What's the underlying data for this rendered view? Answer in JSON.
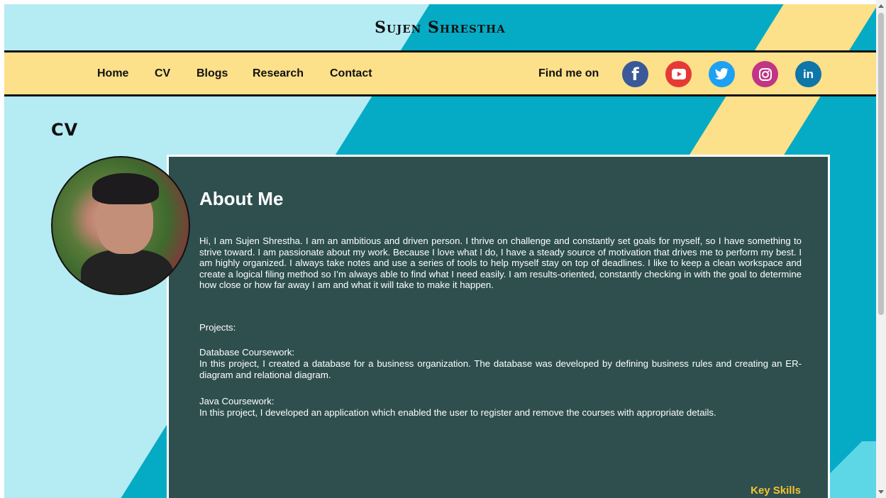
{
  "site": {
    "title": "Sujen Shrestha"
  },
  "nav": {
    "items": [
      {
        "label": "Home"
      },
      {
        "label": "CV"
      },
      {
        "label": "Blogs"
      },
      {
        "label": "Research"
      },
      {
        "label": "Contact"
      }
    ],
    "find_label": "Find me on",
    "socials": [
      {
        "name": "facebook-icon",
        "glyph": "f",
        "color": "#3b5998"
      },
      {
        "name": "youtube-icon",
        "glyph": "",
        "color": "#e53935"
      },
      {
        "name": "twitter-icon",
        "glyph": "",
        "color": "#1da1f2"
      },
      {
        "name": "instagram-icon",
        "glyph": "",
        "color": "#c13584"
      },
      {
        "name": "linkedin-icon",
        "glyph": "in",
        "color": "#0e76a8"
      }
    ]
  },
  "page": {
    "heading": "CV"
  },
  "about": {
    "title": "About Me",
    "intro": "Hi, I am Sujen Shrestha. I am an ambitious and driven person. I thrive on challenge and constantly set goals for myself, so I have something to strive toward. I am passionate about my work. Because I love what I do, I have a steady source of motivation that drives me to perform my best. I am highly organized. I always take notes and use a series of tools to help myself stay on top of deadlines. I like to keep a clean workspace and create a logical filing method so I’m always able to find what I need easily. I am results-oriented, constantly checking in with the goal to determine how close or how far away I am and what it will take to make it happen.",
    "projects_label": "Projects:",
    "project1_title": "Database Coursework:",
    "project1_desc": "In this project, I created a database for a business organization. The database was developed by defining business rules and creating an ER-diagram and relational diagram.",
    "project2_title": "Java Coursework:",
    "project2_desc": "In this project, I developed an application which enabled the user to register and remove the courses with appropriate details.",
    "key_skills": "Key Skills"
  }
}
